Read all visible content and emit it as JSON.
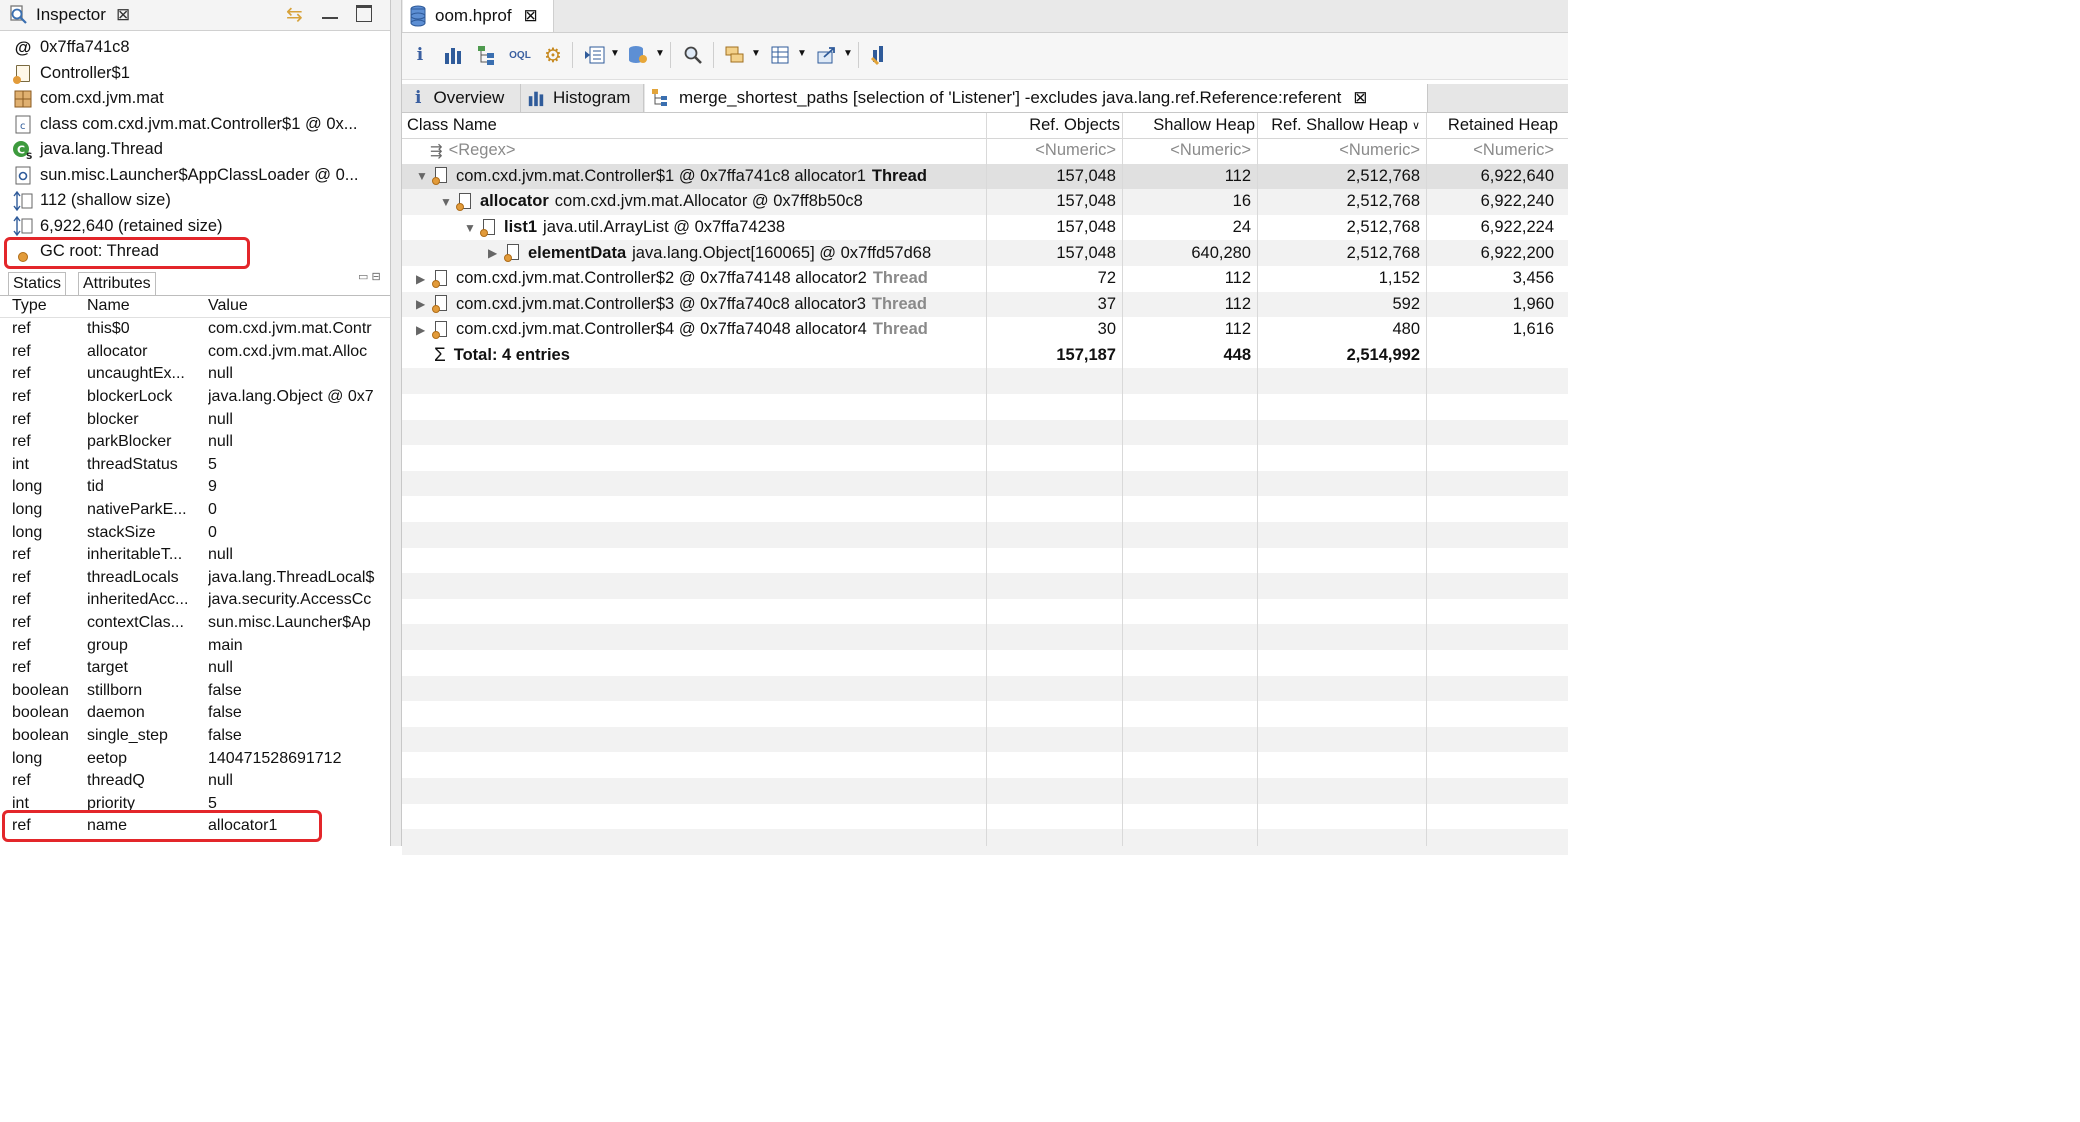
{
  "inspector": {
    "tab_title": "Inspector",
    "rows": [
      {
        "icon": "at-icon",
        "glyph": "@",
        "text": "0x7ffa741c8"
      },
      {
        "icon": "class-object-icon",
        "glyph": "",
        "text": "Controller$1"
      },
      {
        "icon": "package-icon",
        "glyph": "⊞",
        "text": "com.cxd.jvm.mat"
      },
      {
        "icon": "class-icon",
        "glyph": "C",
        "text": "class com.cxd.jvm.mat.Controller$1 @ 0x..."
      },
      {
        "icon": "superclass-icon",
        "glyph": "C",
        "text": "java.lang.Thread"
      },
      {
        "icon": "classloader-icon",
        "glyph": "⚙",
        "text": "sun.misc.Launcher$AppClassLoader @ 0..."
      },
      {
        "icon": "shallow-size-icon",
        "glyph": "↕",
        "text": "112 (shallow size)"
      },
      {
        "icon": "retained-size-icon",
        "glyph": "↕",
        "text": "6,922,640 (retained size)"
      },
      {
        "icon": "gc-root-icon",
        "glyph": "●",
        "text": "GC root: Thread"
      }
    ],
    "subtabs": [
      "Statics",
      "Attributes"
    ],
    "columns": [
      "Type",
      "Name",
      "Value"
    ],
    "attributes": [
      [
        "ref",
        "this$0",
        "com.cxd.jvm.mat.Contr"
      ],
      [
        "ref",
        "allocator",
        "com.cxd.jvm.mat.Alloc"
      ],
      [
        "ref",
        "uncaughtEx...",
        "null"
      ],
      [
        "ref",
        "blockerLock",
        "java.lang.Object @ 0x7"
      ],
      [
        "ref",
        "blocker",
        "null"
      ],
      [
        "ref",
        "parkBlocker",
        "null"
      ],
      [
        "int",
        "threadStatus",
        "5"
      ],
      [
        "long",
        "tid",
        "9"
      ],
      [
        "long",
        "nativeParkE...",
        "0"
      ],
      [
        "long",
        "stackSize",
        "0"
      ],
      [
        "ref",
        "inheritableT...",
        "null"
      ],
      [
        "ref",
        "threadLocals",
        "java.lang.ThreadLocal$"
      ],
      [
        "ref",
        "inheritedAcc...",
        "java.security.AccessCc"
      ],
      [
        "ref",
        "contextClas...",
        "sun.misc.Launcher$Ap"
      ],
      [
        "ref",
        "group",
        "main"
      ],
      [
        "ref",
        "target",
        "null"
      ],
      [
        "boolean",
        "stillborn",
        "false"
      ],
      [
        "boolean",
        "daemon",
        "false"
      ],
      [
        "boolean",
        "single_step",
        "false"
      ],
      [
        "long",
        "eetop",
        "140471528691712"
      ],
      [
        "ref",
        "threadQ",
        "null"
      ],
      [
        "int",
        "priority",
        "5"
      ],
      [
        "ref",
        "name",
        "allocator1"
      ]
    ]
  },
  "editor": {
    "file_tab": "oom.hprof",
    "subtabs": {
      "overview": "Overview",
      "histogram": "Histogram",
      "query": "merge_shortest_paths [selection of 'Listener'] -excludes java.lang.ref.Reference:referent"
    },
    "columns": {
      "class_name": "Class Name",
      "ref_objects": "Ref. Objects",
      "shallow_heap": "Shallow Heap",
      "ref_shallow_heap": "Ref. Shallow Heap",
      "retained_heap": "Retained Heap"
    },
    "filter_row": {
      "regex": "<Regex>",
      "numeric": "<Numeric>"
    },
    "rows": [
      {
        "level": 0,
        "expander": "▼",
        "bold_name": "",
        "name": "com.cxd.jvm.mat.Controller$1 @ 0x7ffa741c8  allocator1",
        "suffix": "Thread",
        "suffix_gray": false,
        "ref_objects": "157,048",
        "shallow": "112",
        "ref_shallow": "2,512,768",
        "retained": "6,922,640"
      },
      {
        "level": 1,
        "expander": "▼",
        "bold_name": "allocator",
        "name": "com.cxd.jvm.mat.Allocator @ 0x7ff8b50c8",
        "suffix": "",
        "suffix_gray": false,
        "ref_objects": "157,048",
        "shallow": "16",
        "ref_shallow": "2,512,768",
        "retained": "6,922,240"
      },
      {
        "level": 2,
        "expander": "▼",
        "bold_name": "list1",
        "name": "java.util.ArrayList @ 0x7ffa74238",
        "suffix": "",
        "suffix_gray": false,
        "ref_objects": "157,048",
        "shallow": "24",
        "ref_shallow": "2,512,768",
        "retained": "6,922,224"
      },
      {
        "level": 3,
        "expander": "▶",
        "bold_name": "elementData",
        "name": "java.lang.Object[160065] @ 0x7ffd57d68",
        "suffix": "",
        "suffix_gray": false,
        "ref_objects": "157,048",
        "shallow": "640,280",
        "ref_shallow": "2,512,768",
        "retained": "6,922,200"
      },
      {
        "level": 0,
        "expander": "▶",
        "bold_name": "",
        "name": "com.cxd.jvm.mat.Controller$2 @ 0x7ffa74148  allocator2",
        "suffix": "Thread",
        "suffix_gray": true,
        "ref_objects": "72",
        "shallow": "112",
        "ref_shallow": "1,152",
        "retained": "3,456"
      },
      {
        "level": 0,
        "expander": "▶",
        "bold_name": "",
        "name": "com.cxd.jvm.mat.Controller$3 @ 0x7ffa740c8  allocator3",
        "suffix": "Thread",
        "suffix_gray": true,
        "ref_objects": "37",
        "shallow": "112",
        "ref_shallow": "592",
        "retained": "1,960"
      },
      {
        "level": 0,
        "expander": "▶",
        "bold_name": "",
        "name": "com.cxd.jvm.mat.Controller$4 @ 0x7ffa74048  allocator4",
        "suffix": "Thread",
        "suffix_gray": true,
        "ref_objects": "30",
        "shallow": "112",
        "ref_shallow": "480",
        "retained": "1,616"
      }
    ],
    "total": {
      "label": "Total: 4 entries",
      "ref_objects": "157,187",
      "shallow": "448",
      "ref_shallow": "2,514,992",
      "retained": ""
    }
  }
}
